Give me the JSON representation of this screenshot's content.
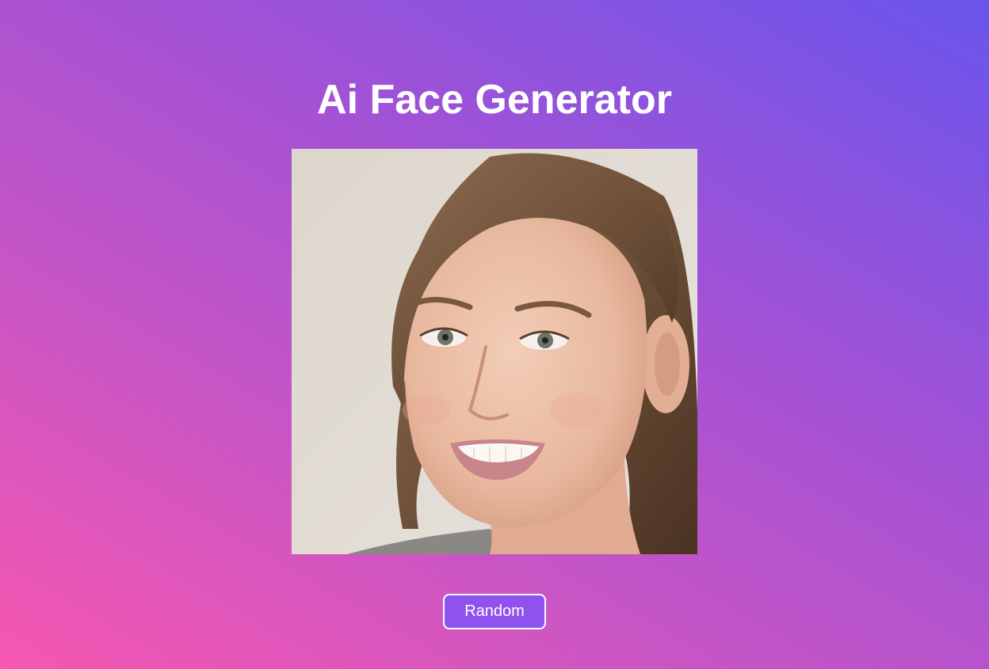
{
  "page": {
    "title": "Ai Face Generator"
  },
  "face_image": {
    "alt": "Generated face portrait"
  },
  "controls": {
    "random_label": "Random"
  },
  "colors": {
    "gradient_start": "#f657b0",
    "gradient_mid": "#a552d4",
    "gradient_end": "#6a55ec",
    "button_bg": "#9052ee",
    "text": "#ffffff"
  }
}
